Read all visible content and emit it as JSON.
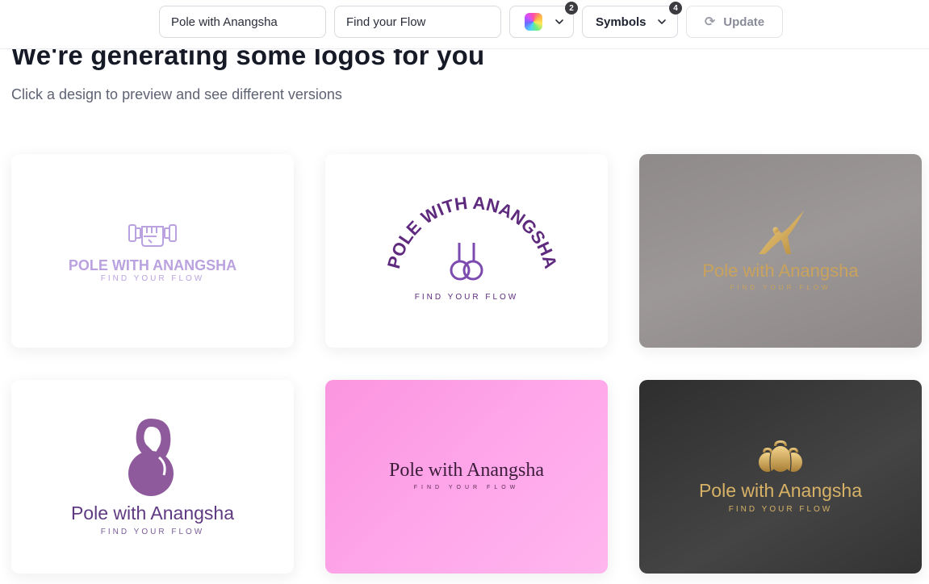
{
  "toolbar": {
    "company_name_value": "Pole with Anangsha",
    "slogan_value": "Find your Flow",
    "color_count": "2",
    "symbols_label": "Symbols",
    "symbols_count": "4",
    "update_label": "Update"
  },
  "header": {
    "title": "We're generating some logos for you",
    "subtitle": "Click a design to preview and see different versions"
  },
  "logos": [
    {
      "name": "POLE WITH ANANGSHA",
      "tagline": "FIND YOUR FLOW",
      "symbol": "fist-dumbbell-icon",
      "colors": {
        "name": "#b9a2df",
        "tagline": "#b9a2df"
      }
    },
    {
      "name": "POLE WITH ANANGSHA",
      "tagline": "FIND YOUR FLOW",
      "symbol": "gymnastic-rings-icon",
      "colors": {
        "name": "#5e2a7e",
        "tagline": "#5e2a7e",
        "symbol": "#7c4bb0"
      }
    },
    {
      "name": "Pole with Anangsha",
      "tagline": "FIND YOUR FLOW",
      "symbol": "yoga-pose-icon",
      "colors": {
        "name": "#c9a25c",
        "tagline": "#c9a25c",
        "background": "#969090"
      }
    },
    {
      "name": "Pole with Anangsha",
      "tagline": "FIND YOUR FLOW",
      "symbol": "kettlebell-icon",
      "colors": {
        "name": "#5f3a82",
        "tagline": "#7a5c98",
        "symbol": "#8e5a9c"
      }
    },
    {
      "name": "Pole with Anangsha",
      "tagline": "FIND YOUR FLOW",
      "symbol": "",
      "colors": {
        "name": "#3b1d3a",
        "tagline": "#5b2b52",
        "background": "#fca1e6"
      }
    },
    {
      "name": "Pole with Anangsha",
      "tagline": "FIND YOUR FLOW",
      "symbol": "kettlebells-icon",
      "colors": {
        "name": "#d7b266",
        "tagline": "#d7b266",
        "background": "#3a3a3a"
      }
    }
  ]
}
